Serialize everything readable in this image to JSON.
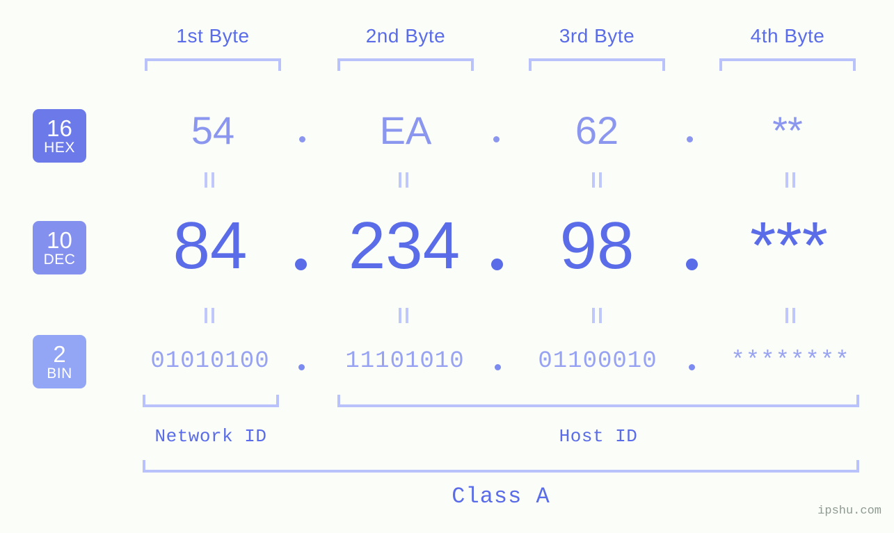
{
  "background_color": "#fbfdf8",
  "accent_colors": {
    "hex_badge": "#6c79e8",
    "dec_badge": "#8490ee",
    "bin_badge": "#93a5f5",
    "hex_text": "#8b96ef",
    "dec_text": "#5a6ce8",
    "bin_text": "#97a3f2",
    "bracket": "#b9c2fb",
    "equals": "#c0c8fb",
    "label_text": "#5a6ce8",
    "watermark": "#8e9a92"
  },
  "byte_headers": [
    {
      "label": "1st Byte"
    },
    {
      "label": "2nd Byte"
    },
    {
      "label": "3rd Byte"
    },
    {
      "label": "4th Byte"
    }
  ],
  "bases": [
    {
      "number": "16",
      "abbr": "HEX"
    },
    {
      "number": "10",
      "abbr": "DEC"
    },
    {
      "number": "2",
      "abbr": "BIN"
    }
  ],
  "rows": {
    "hex": {
      "values": [
        "54",
        "EA",
        "62",
        "**"
      ],
      "separator": "."
    },
    "dec": {
      "values": [
        "84",
        "234",
        "98",
        "***"
      ],
      "separator": "."
    },
    "bin": {
      "values": [
        "01010100",
        "11101010",
        "01100010",
        "********"
      ],
      "separator": "."
    }
  },
  "equals_symbol": "=",
  "segments": {
    "network_id": "Network ID",
    "host_id": "Host ID"
  },
  "class_label": "Class A",
  "watermark": "ipshu.com"
}
